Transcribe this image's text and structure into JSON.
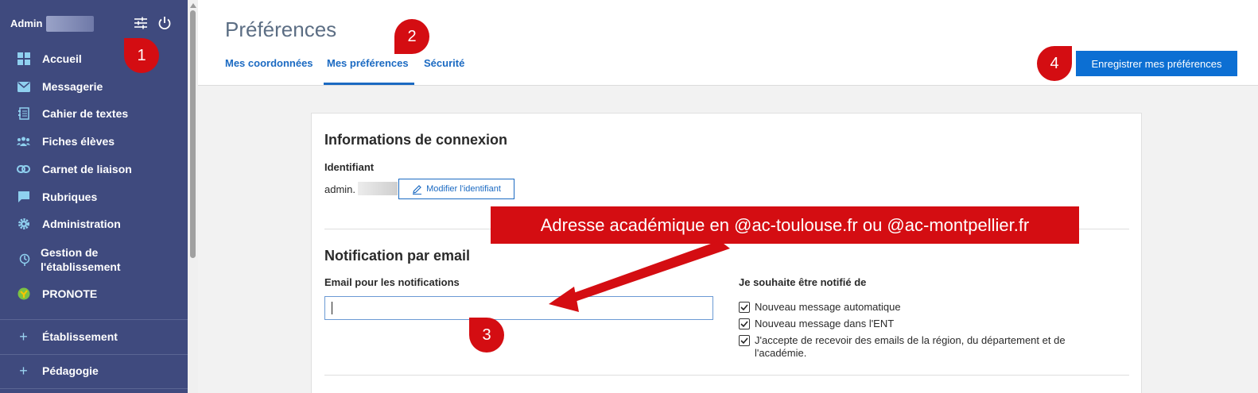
{
  "sidebar": {
    "user_label": "Admin",
    "items": [
      {
        "label": "Accueil",
        "icon": "grid-icon"
      },
      {
        "label": "Messagerie",
        "icon": "mail-icon"
      },
      {
        "label": "Cahier de textes",
        "icon": "notebook-icon"
      },
      {
        "label": "Fiches élèves",
        "icon": "students-icon"
      },
      {
        "label": "Carnet de liaison",
        "icon": "link-icon"
      },
      {
        "label": "Rubriques",
        "icon": "chat-icon"
      },
      {
        "label": "Administration",
        "icon": "gear-icon"
      },
      {
        "label": "Gestion de\nl'établissement",
        "icon": "school-icon"
      },
      {
        "label": "PRONOTE",
        "icon": "pronote-icon"
      }
    ],
    "sections": [
      {
        "label": "Établissement"
      },
      {
        "label": "Pédagogie"
      }
    ]
  },
  "header": {
    "title": "Préférences",
    "tabs": [
      {
        "label": "Mes coordonnées"
      },
      {
        "label": "Mes préférences"
      },
      {
        "label": "Sécurité"
      }
    ],
    "save_label": "Enregistrer mes préférences"
  },
  "card": {
    "connexion_title": "Informations de connexion",
    "identifiant_label": "Identifiant",
    "identifiant_value": "admin.",
    "modifier_label": "Modifier l'identifiant",
    "notif_title": "Notification par email",
    "email_label": "Email pour les notifications",
    "email_value": "",
    "notify_label": "Je souhaite être notifié de",
    "checkboxes": [
      {
        "label": "Nouveau message automatique",
        "checked": true
      },
      {
        "label": "Nouveau message dans l'ENT",
        "checked": true
      },
      {
        "label": "J'accepte de recevoir des emails de la région, du département et de l'académie.",
        "checked": true
      }
    ]
  },
  "annotations": {
    "badge1": "1",
    "badge2": "2",
    "badge3": "3",
    "badge4": "4",
    "banner": "Adresse académique en @ac-toulouse.fr ou @ac-montpellier.fr"
  }
}
